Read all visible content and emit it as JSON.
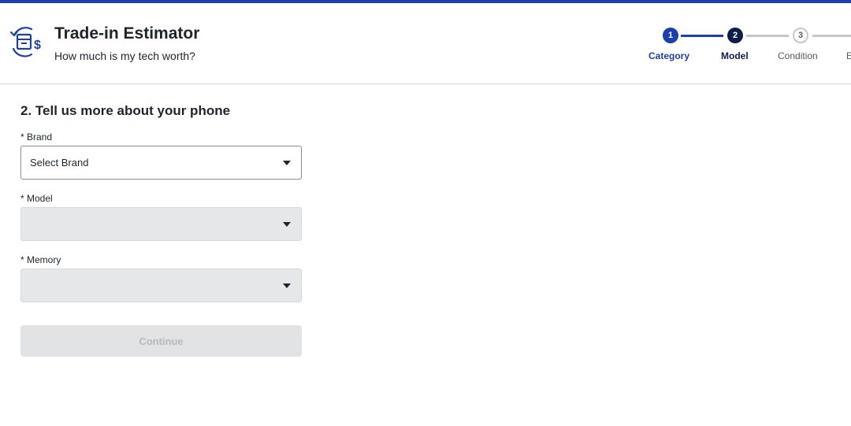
{
  "header": {
    "title": "Trade-in Estimator",
    "subtitle": "How much is my tech worth?",
    "logo_icon": "trade-in-box-dollar-icon"
  },
  "stepper": {
    "steps": [
      {
        "number": "1",
        "label": "Category",
        "state": "completed"
      },
      {
        "number": "2",
        "label": "Model",
        "state": "current"
      },
      {
        "number": "3",
        "label": "Condition",
        "state": "upcoming"
      },
      {
        "number": "",
        "label": "E",
        "state": "upcoming"
      }
    ]
  },
  "form": {
    "section_title": "2. Tell us more about your phone",
    "brand": {
      "label": "* Brand",
      "value": "Select Brand",
      "disabled": false
    },
    "model": {
      "label": "* Model",
      "value": "",
      "disabled": true
    },
    "memory": {
      "label": "* Memory",
      "value": "",
      "disabled": true
    },
    "continue_label": "Continue"
  },
  "colors": {
    "accent": "#1d3fa8",
    "current_step": "#0e1d4a",
    "disabled_bg": "#e6e7e9"
  }
}
